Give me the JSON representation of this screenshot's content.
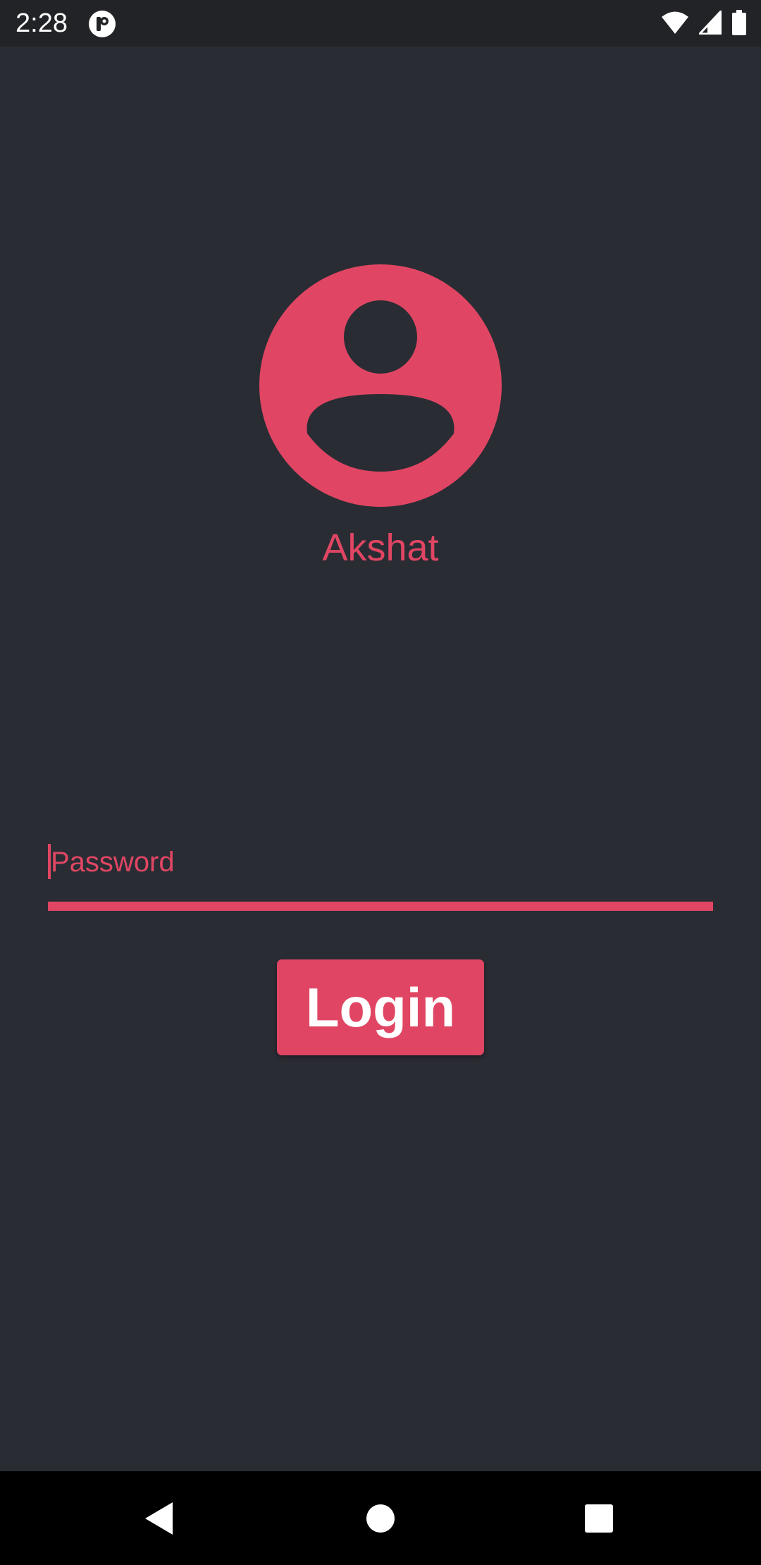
{
  "status_bar": {
    "time": "2:28",
    "app_icon": "p-notification-icon",
    "icons": [
      "wifi-icon",
      "signal-icon",
      "battery-icon"
    ]
  },
  "profile": {
    "avatar_icon": "account-circle-icon",
    "name": "Akshat"
  },
  "password_field": {
    "placeholder": "Password",
    "value": ""
  },
  "login_button": {
    "label": "Login"
  },
  "navigation_bar": {
    "buttons": [
      "back-icon",
      "home-icon",
      "recents-icon"
    ]
  },
  "colors": {
    "accent": "#e04663",
    "background": "#2a2c34",
    "status_bar": "#222327",
    "nav_bar": "#000000",
    "text_on_accent": "#ffffff"
  }
}
